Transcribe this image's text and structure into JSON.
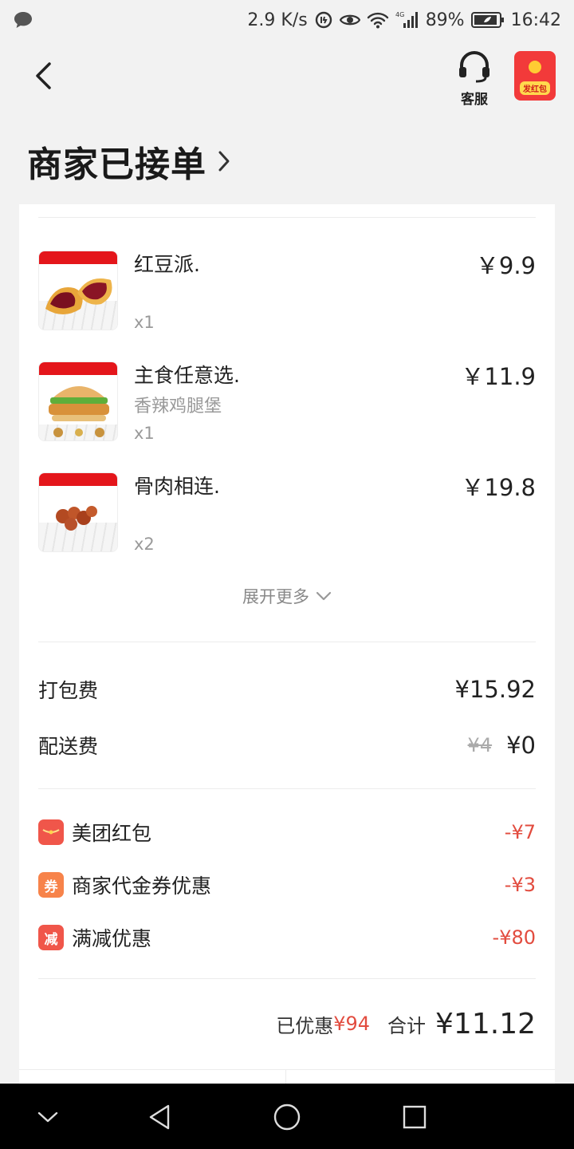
{
  "status_bar": {
    "speed": "2.9 K/s",
    "battery": "89%",
    "time": "16:42",
    "net": "4G"
  },
  "header": {
    "customer_service": "客服",
    "red_packet": "发红包"
  },
  "order_status": "商家已接单",
  "items": [
    {
      "name": "红豆派.",
      "spec": "",
      "qty": "x1",
      "price": "￥9.9",
      "thumb_banner": "#e4161b"
    },
    {
      "name": "主食任意选.",
      "spec": "香辣鸡腿堡",
      "qty": "x1",
      "price": "￥11.9",
      "thumb_banner": "#e4161b"
    },
    {
      "name": "骨肉相连.",
      "spec": "",
      "qty": "x2",
      "price": "￥19.8",
      "thumb_banner": "#e4161b"
    }
  ],
  "expand_more": "展开更多",
  "fees": {
    "packing_label": "打包费",
    "packing_value": "¥15.92",
    "delivery_label": "配送费",
    "delivery_original": "¥4",
    "delivery_value": "¥0"
  },
  "discounts": [
    {
      "label": "美团红包",
      "value": "-¥7",
      "icon": "red-packet-icon",
      "icon_text": "",
      "color": "#f0564a"
    },
    {
      "label": "商家代金券优惠",
      "value": "-¥3",
      "icon": "voucher-icon",
      "icon_text": "券",
      "color": "#f7834a"
    },
    {
      "label": "满减优惠",
      "value": "-¥80",
      "icon": "reduction-icon",
      "icon_text": "减",
      "color": "#f0564a"
    }
  ],
  "summary": {
    "saved_label": "已优惠",
    "saved_value": "¥94",
    "total_label": "合计",
    "total_value": "¥11.12"
  },
  "colors": {
    "accent_red": "#e24c3f",
    "background": "#f2f2f2"
  }
}
